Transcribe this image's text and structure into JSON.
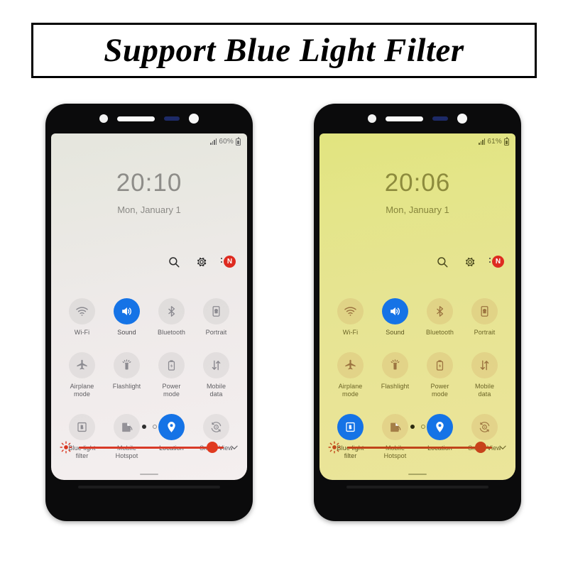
{
  "banner": {
    "title": "Support Blue Light Filter"
  },
  "phones": [
    {
      "variant": "normal",
      "name": "phone-filter-off",
      "status": {
        "battery": "60%",
        "signal_icon": "signal-bars-icon",
        "battery_icon": "battery-icon"
      },
      "clock": {
        "time": "20:10",
        "date": "Mon, January 1"
      },
      "actions": [
        {
          "name": "search-icon",
          "label": "Search"
        },
        {
          "name": "gear-icon",
          "label": "Settings"
        },
        {
          "name": "notification-badge-icon",
          "label": "N"
        }
      ],
      "tiles": [
        {
          "label": "Wi-Fi",
          "icon": "wifi-icon",
          "state": "off"
        },
        {
          "label": "Sound",
          "icon": "sound-icon",
          "state": "on"
        },
        {
          "label": "Bluetooth",
          "icon": "bluetooth-icon",
          "state": "off"
        },
        {
          "label": "Portrait",
          "icon": "portrait-rotation-icon",
          "state": "off"
        },
        {
          "label": "Airplane mode",
          "icon": "airplane-icon",
          "state": "off"
        },
        {
          "label": "Flashlight",
          "icon": "flashlight-icon",
          "state": "off"
        },
        {
          "label": "Power mode",
          "icon": "power-mode-icon",
          "state": "off"
        },
        {
          "label": "Mobile data",
          "icon": "mobile-data-icon",
          "state": "off"
        },
        {
          "label": "Blue light filter",
          "icon": "blue-light-filter-icon",
          "state": "off"
        },
        {
          "label": "Mobile Hotspot",
          "icon": "mobile-hotspot-icon",
          "state": "off"
        },
        {
          "label": "Location",
          "icon": "location-pin-icon",
          "state": "on"
        },
        {
          "label": "Smart View",
          "icon": "smart-view-icon",
          "state": "off"
        }
      ],
      "pages": {
        "count": 2,
        "current": 1
      },
      "brightness": {
        "icon": "brightness-sun-icon",
        "percent": 92,
        "expand_icon": "chevron-down-icon"
      }
    },
    {
      "variant": "filtered",
      "name": "phone-filter-on",
      "status": {
        "battery": "61%",
        "signal_icon": "signal-bars-icon",
        "battery_icon": "battery-icon"
      },
      "clock": {
        "time": "20:06",
        "date": "Mon, January 1"
      },
      "actions": [
        {
          "name": "search-icon",
          "label": "Search"
        },
        {
          "name": "gear-icon",
          "label": "Settings"
        },
        {
          "name": "notification-badge-icon",
          "label": "N"
        }
      ],
      "tiles": [
        {
          "label": "Wi-Fi",
          "icon": "wifi-icon",
          "state": "off"
        },
        {
          "label": "Sound",
          "icon": "sound-icon",
          "state": "on"
        },
        {
          "label": "Bluetooth",
          "icon": "bluetooth-icon",
          "state": "off"
        },
        {
          "label": "Portrait",
          "icon": "portrait-rotation-icon",
          "state": "off"
        },
        {
          "label": "Airplane mode",
          "icon": "airplane-icon",
          "state": "off"
        },
        {
          "label": "Flashlight",
          "icon": "flashlight-icon",
          "state": "off"
        },
        {
          "label": "Power mode",
          "icon": "power-mode-icon",
          "state": "off"
        },
        {
          "label": "Mobile data",
          "icon": "mobile-data-icon",
          "state": "off"
        },
        {
          "label": "Blue light filter",
          "icon": "blue-light-filter-icon",
          "state": "on"
        },
        {
          "label": "Mobile Hotspot",
          "icon": "mobile-hotspot-icon",
          "state": "off"
        },
        {
          "label": "Location",
          "icon": "location-pin-icon",
          "state": "on"
        },
        {
          "label": "Smart View",
          "icon": "smart-view-icon",
          "state": "off"
        }
      ],
      "pages": {
        "count": 2,
        "current": 1
      },
      "brightness": {
        "icon": "brightness-sun-icon",
        "percent": 92,
        "expand_icon": "chevron-down-icon"
      }
    }
  ],
  "colors": {
    "accent_on": "#1573e6",
    "slider_red": "#d83a27",
    "badge_red": "#de2b20",
    "screen_normal": "#eeeae9",
    "screen_filtered": "#e6e492",
    "bezel": "#0b0b0c"
  }
}
